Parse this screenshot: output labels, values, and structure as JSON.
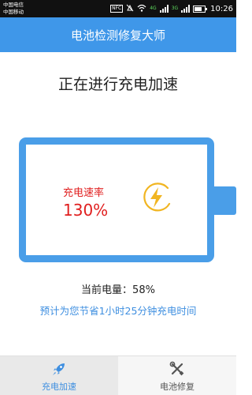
{
  "status_bar": {
    "carrier_1": "中国电信",
    "carrier_2": "中国移动",
    "nfc": "NFC",
    "network_1": "4G",
    "network_2": "3G",
    "battery_level": 0.75,
    "time": "10:26"
  },
  "header": {
    "title": "电池检测修复大师"
  },
  "main": {
    "heading": "正在进行充电加速",
    "speed_label": "充电速率",
    "speed_value": "130%",
    "charge_line": "当前电量：58%",
    "saving_line": "预计为您节省1小时25分钟充电时间"
  },
  "tabs": [
    {
      "label": "充电加速",
      "icon": "rocket-icon",
      "active": true
    },
    {
      "label": "电池修复",
      "icon": "tools-icon",
      "active": false
    }
  ],
  "colors": {
    "primary": "#3f97e9",
    "battery_outline": "#4a9ee8",
    "speed_text": "#e01e1e",
    "bolt": "#f1b521",
    "saving_text": "#3f8fe0"
  }
}
